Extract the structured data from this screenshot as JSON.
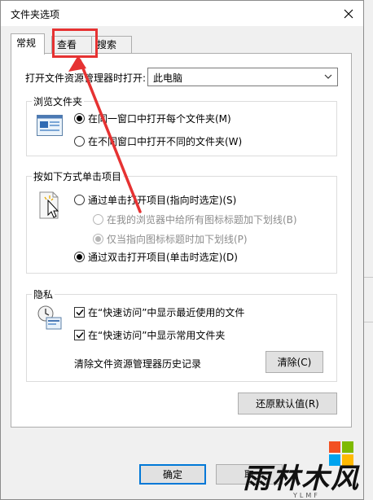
{
  "window": {
    "title": "文件夹选项"
  },
  "tabs": [
    {
      "label": "常规",
      "active": true
    },
    {
      "label": "查看",
      "active": false
    },
    {
      "label": "搜索",
      "active": false
    }
  ],
  "open_with": {
    "label": "打开文件资源管理器时打开:",
    "value": "此电脑"
  },
  "browse": {
    "title": "浏览文件夹",
    "options": [
      {
        "label": "在同一窗口中打开每个文件夹(M)",
        "checked": true
      },
      {
        "label": "在不同窗口中打开不同的文件夹(W)",
        "checked": false
      }
    ]
  },
  "click": {
    "title": "按如下方式单击项目",
    "options": [
      {
        "label": "通过单击打开项目(指向时选定)(S)",
        "checked": false,
        "disabled": false
      },
      {
        "label": "在我的浏览器中给所有图标标题加下划线(B)",
        "checked": false,
        "disabled": true
      },
      {
        "label": "仅当指向图标标题时加下划线(P)",
        "checked": true,
        "disabled": true
      },
      {
        "label": "通过双击打开项目(单击时选定)(D)",
        "checked": true,
        "disabled": false
      }
    ]
  },
  "privacy": {
    "title": "隐私",
    "checks": [
      {
        "label": "在“快速访问”中显示最近使用的文件",
        "checked": true
      },
      {
        "label": "在“快速访问”中显示常用文件夹",
        "checked": true
      }
    ],
    "clear_label": "清除文件资源管理器历史记录",
    "clear_button": "清除(C)"
  },
  "restore_button": "还原默认值(R)",
  "ok_button": "确定",
  "cancel_button": "取",
  "watermark": {
    "text": "雨林木风",
    "sub": "YLMF"
  },
  "colors": {
    "annotation": "#e63232",
    "accent": "#0078d7"
  }
}
